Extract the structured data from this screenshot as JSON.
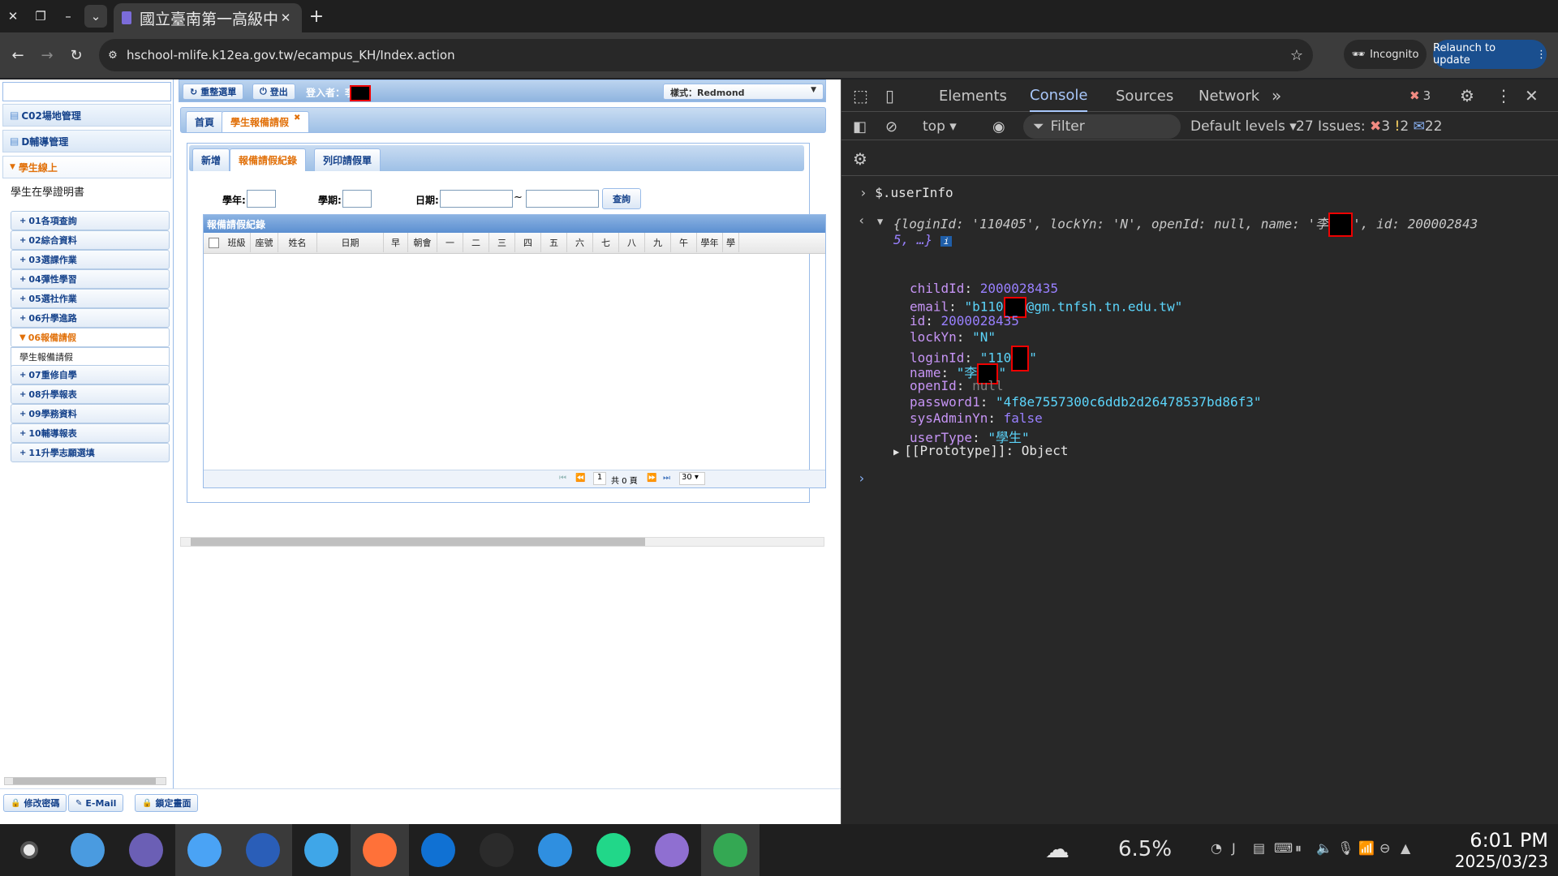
{
  "browser": {
    "tab_title": "國立臺南第一高級中學",
    "url": "hschool-mlife.k12ea.gov.tw/ecampus_KH/Index.action",
    "incognito": "Incognito",
    "relaunch": "Relaunch to update"
  },
  "page": {
    "sidebar": {
      "groups": [
        {
          "label": "C02場地管理"
        },
        {
          "label": "D輔導管理"
        },
        {
          "label": "學生線上"
        }
      ],
      "cert_label": "學生在學證明書",
      "menu": [
        {
          "label": "01各項查詢"
        },
        {
          "label": "02綜合資料"
        },
        {
          "label": "03選課作業"
        },
        {
          "label": "04彈性學習"
        },
        {
          "label": "05選社作業"
        },
        {
          "label": "06升學進路"
        },
        {
          "label": "06報備請假"
        },
        {
          "label": "學生報備請假"
        },
        {
          "label": "07重修自學"
        },
        {
          "label": "08升學報表"
        },
        {
          "label": "09學務資料"
        },
        {
          "label": "10輔導報表"
        },
        {
          "label": "11升學志願選填"
        }
      ],
      "bottom_buttons": [
        "修改密碼",
        "E-Mail",
        "鎖定畫面"
      ]
    },
    "topbar": {
      "reload": "重整選單",
      "logout": "登出",
      "login_label": "登入者：李",
      "style": "樣式：Redmond"
    },
    "tabs": [
      "首頁",
      "學生報備請假"
    ],
    "subtabs": [
      "新增",
      "報備請假紀錄",
      "列印請假單"
    ],
    "form": {
      "year": "學年:",
      "term": "學期:",
      "date": "日期:",
      "tilde": "~",
      "query": "查詢"
    },
    "grid": {
      "title": "報備請假紀錄",
      "columns": [
        "班級",
        "座號",
        "姓名",
        "日期",
        "早",
        "朝會",
        "一",
        "二",
        "三",
        "四",
        "五",
        "六",
        "七",
        "八",
        "九",
        "午",
        "學年",
        "學"
      ],
      "pager_page": "1",
      "pager_total": "共 0 頁",
      "page_size": "30"
    }
  },
  "devtools": {
    "tabs": [
      "Elements",
      "Console",
      "Sources",
      "Network"
    ],
    "error_count": "3",
    "context": "top",
    "filter_placeholder": "Filter",
    "levels": "Default levels",
    "issues_label": "27 Issues:",
    "issues_err": "3",
    "issues_warn": "2",
    "issues_info": "22",
    "command": "$.userInfo",
    "summary_a": "{loginId: '110405', lockYn: 'N', openId: null, name: '李",
    "summary_b": "', id: 200002843",
    "summary_c": "5, …}",
    "props": [
      {
        "key": "childId",
        "val": "2000028435",
        "type": "num"
      },
      {
        "key": "email",
        "val": "\"b110",
        "val2": "@gm.tnfsh.tn.edu.tw\"",
        "type": "str"
      },
      {
        "key": "id",
        "val": "2000028435",
        "type": "num"
      },
      {
        "key": "lockYn",
        "val": "\"N\"",
        "type": "str"
      },
      {
        "key": "loginId",
        "val": "\"110",
        "val2": "\"",
        "type": "str"
      },
      {
        "key": "name",
        "val": "\"李",
        "val2": "\"",
        "type": "str"
      },
      {
        "key": "openId",
        "val": "null",
        "type": "null"
      },
      {
        "key": "password1",
        "val": "\"4f8e7557300c6ddb2d26478537bd86f3\"",
        "type": "str"
      },
      {
        "key": "sysAdminYn",
        "val": "false",
        "type": "bool"
      },
      {
        "key": "userType",
        "val": "\"學生\"",
        "type": "str"
      }
    ],
    "prototype": "[[Prototype]]: Object"
  },
  "taskbar": {
    "weather": "6.5%",
    "time": "6:01 PM",
    "date": "2025/03/23"
  }
}
